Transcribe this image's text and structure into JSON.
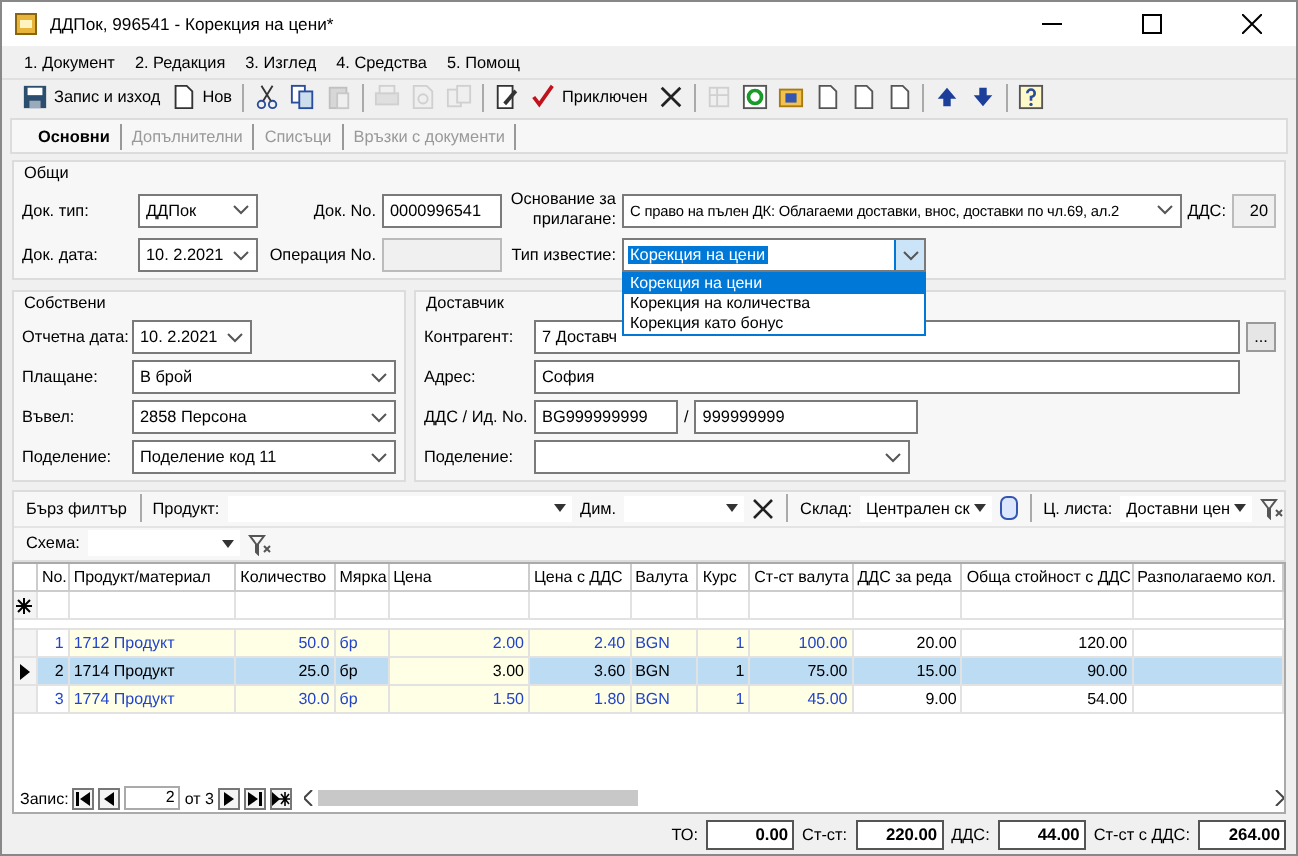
{
  "window": {
    "title": "ДДПок, 996541 - Корекция на цени*"
  },
  "menu": [
    "1. Документ",
    "2. Редакция",
    "3. Изглед",
    "4. Средства",
    "5. Помощ"
  ],
  "toolbar": [
    {
      "kind": "button",
      "label": "Запис и изход",
      "disabled": false
    },
    {
      "kind": "button",
      "label": "Нов",
      "disabled": false
    },
    {
      "kind": "separator"
    },
    {
      "kind": "icon",
      "disabled": false
    },
    {
      "kind": "icon",
      "disabled": false
    },
    {
      "kind": "icon",
      "disabled": true
    },
    {
      "kind": "separator"
    },
    {
      "kind": "icon",
      "disabled": true
    },
    {
      "kind": "icon",
      "disabled": true
    },
    {
      "kind": "icon",
      "disabled": true
    },
    {
      "kind": "separator"
    },
    {
      "kind": "icon",
      "disabled": false
    },
    {
      "kind": "button",
      "label": "Приключен",
      "disabled": false
    },
    {
      "kind": "icon",
      "disabled": false
    },
    {
      "kind": "separator"
    },
    {
      "kind": "icon",
      "disabled": true
    },
    {
      "kind": "icon",
      "disabled": false
    },
    {
      "kind": "icon",
      "disabled": false
    },
    {
      "kind": "icon",
      "disabled": false
    },
    {
      "kind": "icon",
      "disabled": false
    },
    {
      "kind": "icon",
      "disabled": false
    },
    {
      "kind": "separator"
    },
    {
      "kind": "icon",
      "disabled": false
    },
    {
      "kind": "icon",
      "disabled": false
    },
    {
      "kind": "separator"
    },
    {
      "kind": "icon",
      "disabled": false
    }
  ],
  "tabs": [
    {
      "label": "Основни",
      "selected": true
    },
    {
      "label": "Допълнителни",
      "selected": false
    },
    {
      "label": "Списъци",
      "selected": false
    },
    {
      "label": "Връзки с документи",
      "selected": false
    }
  ],
  "general": {
    "title": "Общи",
    "doc_type": {
      "label": "Док. тип:",
      "value": "ДДПок"
    },
    "doc_no": {
      "label": "Док. No.",
      "value": "0000996541"
    },
    "basis": {
      "label": "Основание за прилагане:",
      "value": "С право на пълен ДК: Облагаеми доставки, внос, доставки по чл.69, ал.2"
    },
    "vat": {
      "label": "ДДС:",
      "value": "20"
    },
    "doc_date": {
      "label": "Док. дата:",
      "value": "10.  2.2021"
    },
    "operation_no": {
      "label": "Операция No."
    },
    "notice_type": {
      "label": "Тип известие:",
      "value": "Корекция на цени",
      "options": [
        {
          "label": "Корекция на цени",
          "selected": true
        },
        {
          "label": "Корекция на количества",
          "selected": false
        },
        {
          "label": "Корекция като бонус",
          "selected": false
        }
      ]
    }
  },
  "own": {
    "title": "Собствени",
    "fields": [
      {
        "label": "Отчетна дата:",
        "value": "10.  2.2021",
        "kind": "date"
      },
      {
        "label": "Плащане:",
        "value": "В брой",
        "kind": "combo"
      },
      {
        "label": "Въвел:",
        "value": "2858 Персона",
        "kind": "combo"
      },
      {
        "label": "Поделение:",
        "value": "Поделение код 11",
        "kind": "combo"
      }
    ]
  },
  "supplier": {
    "title": "Доставчик",
    "contragent": {
      "label": "Контрагент:",
      "value": "7 Доставч",
      "button": "..."
    },
    "address": {
      "label": "Адрес:",
      "value": "София"
    },
    "vat_id": {
      "label": "ДДС / Ид. No.",
      "vat": "BG999999999",
      "separator": "/",
      "id": "999999999"
    },
    "division": {
      "label": "Поделение:"
    }
  },
  "filter": {
    "quick_filter": "Бърз филтър",
    "product": "Продукт:",
    "dim": "Дим.",
    "warehouse": {
      "label": "Склад:",
      "value": "Централен ск"
    },
    "price_list": {
      "label": "Ц. листа:",
      "value": "Доставни цен"
    },
    "scheme": "Схема:"
  },
  "table": {
    "columns": [
      {
        "label": "No.",
        "kind": "number",
        "editable": false,
        "focused": false
      },
      {
        "label": "Продукт/материал",
        "kind": "text",
        "editable": true,
        "focused": false
      },
      {
        "label": "Количество",
        "kind": "number",
        "editable": true,
        "focused": false
      },
      {
        "label": "Мярка",
        "kind": "text",
        "editable": true,
        "focused": false
      },
      {
        "label": "Цена",
        "kind": "number",
        "editable": true,
        "focused": true
      },
      {
        "label": "Цена с ДДС",
        "kind": "number",
        "editable": true,
        "focused": false
      },
      {
        "label": "Валута",
        "kind": "text",
        "editable": true,
        "focused": false
      },
      {
        "label": "Курс",
        "kind": "number",
        "editable": true,
        "focused": false
      },
      {
        "label": "Ст-ст валута",
        "kind": "number",
        "editable": true,
        "focused": false
      },
      {
        "label": "ДДС за реда",
        "kind": "number",
        "editable": false,
        "focused": false
      },
      {
        "label": "Обща стойност с ДДС",
        "kind": "number",
        "editable": false,
        "focused": false
      },
      {
        "label": "Разполагаемо кол.",
        "kind": "number",
        "editable": false,
        "focused": false
      }
    ],
    "rows": [
      {
        "selected": false,
        "cells": [
          "1",
          "1712 Продукт",
          "50.0",
          "бр",
          "2.00",
          "2.40",
          "BGN",
          "1",
          "100.00",
          "20.00",
          "120.00",
          ""
        ]
      },
      {
        "selected": true,
        "cells": [
          "2",
          "1714 Продукт",
          "25.0",
          "бр",
          "3.00",
          "3.60",
          "BGN",
          "1",
          "75.00",
          "15.00",
          "90.00",
          ""
        ]
      },
      {
        "selected": false,
        "cells": [
          "3",
          "1774 Продукт",
          "30.0",
          "бр",
          "1.50",
          "1.80",
          "BGN",
          "1",
          "45.00",
          "9.00",
          "54.00",
          ""
        ]
      }
    ]
  },
  "navigator": {
    "label": "Запис:",
    "current": "2",
    "of": "от 3"
  },
  "totals": [
    {
      "label": "ТО:",
      "value": "0.00"
    },
    {
      "label": "Ст-ст:",
      "value": "220.00"
    },
    {
      "label": "ДДС:",
      "value": "44.00"
    },
    {
      "label": "Ст-ст с ДДС:",
      "value": "264.00"
    }
  ]
}
